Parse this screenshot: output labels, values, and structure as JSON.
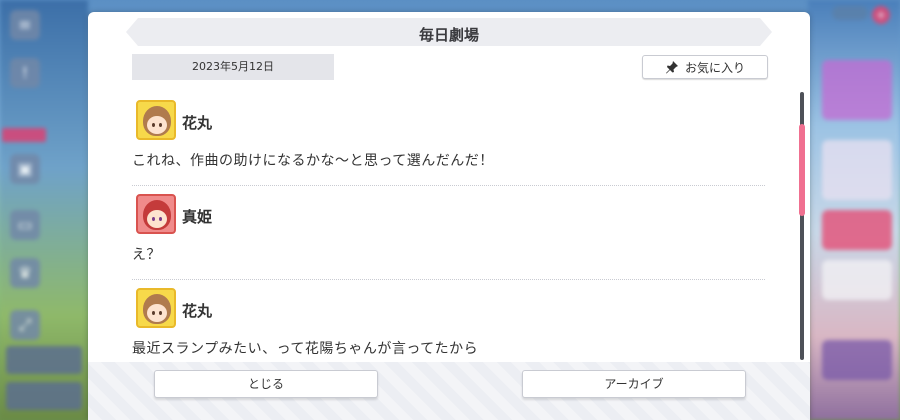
{
  "dialog": {
    "title": "毎日劇場",
    "date": "2023年5月12日",
    "favorite_label": "お気に入り",
    "entries": [
      {
        "speaker": "花丸",
        "avatar": "hanamaru-avatar",
        "text": "これね、作曲の助けになるかな～と思って選んだんだ！"
      },
      {
        "speaker": "真姫",
        "avatar": "maki-avatar",
        "text": "え？"
      },
      {
        "speaker": "花丸",
        "avatar": "hanamaru-avatar",
        "text": "最近スランプみたい、って花陽ちゃんが言ってたから"
      }
    ],
    "close_label": "とじる",
    "archive_label": "アーカイブ"
  },
  "colors": {
    "accent_pink": "#f07090",
    "avatar_yellow": "#f7d94a",
    "avatar_red": "#f08b8b"
  }
}
